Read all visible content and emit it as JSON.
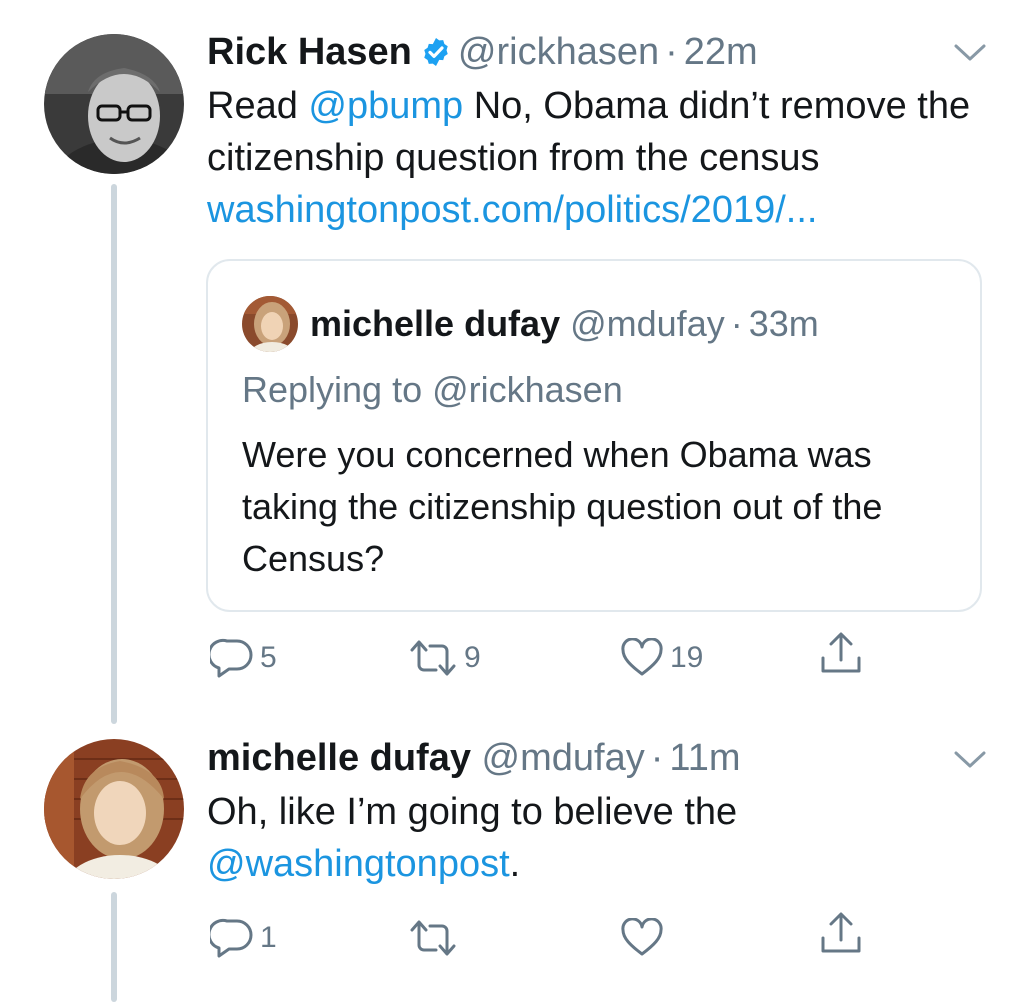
{
  "tweet1": {
    "author_name": "Rick Hasen",
    "author_handle": "@rickhasen",
    "separator": "·",
    "time": "22m",
    "text_prefix": "Read ",
    "mention": "@pbump",
    "text_rest": " No, Obama didn’t remove the citizenship question from the census",
    "link": "washingtonpost.com/politics/2019/...",
    "quote": {
      "author_name": "michelle dufay",
      "author_handle": "@mdufay",
      "separator": "·",
      "time": "33m",
      "replying_to": "Replying to @rickhasen",
      "text": "Were you concerned when Obama was taking the citizenship question out of the Census?"
    },
    "actions": {
      "reply_count": "5",
      "retweet_count": "9",
      "like_count": "19"
    }
  },
  "tweet2": {
    "author_name": "michelle dufay",
    "author_handle": "@mdufay",
    "separator": "·",
    "time": "11m",
    "text": "Oh, like I’m going to believe the",
    "mention": "@washingtonpost",
    "text_end": ".",
    "actions": {
      "reply_count": "1"
    }
  },
  "colors": {
    "link": "#1b95e0",
    "secondary_text": "#657786",
    "thread_line": "#ccd6dd",
    "verified_badge": "#1da1f2"
  },
  "icons": [
    "verified-badge-icon",
    "chevron-down-icon",
    "reply-icon",
    "retweet-icon",
    "like-icon",
    "share-icon"
  ]
}
